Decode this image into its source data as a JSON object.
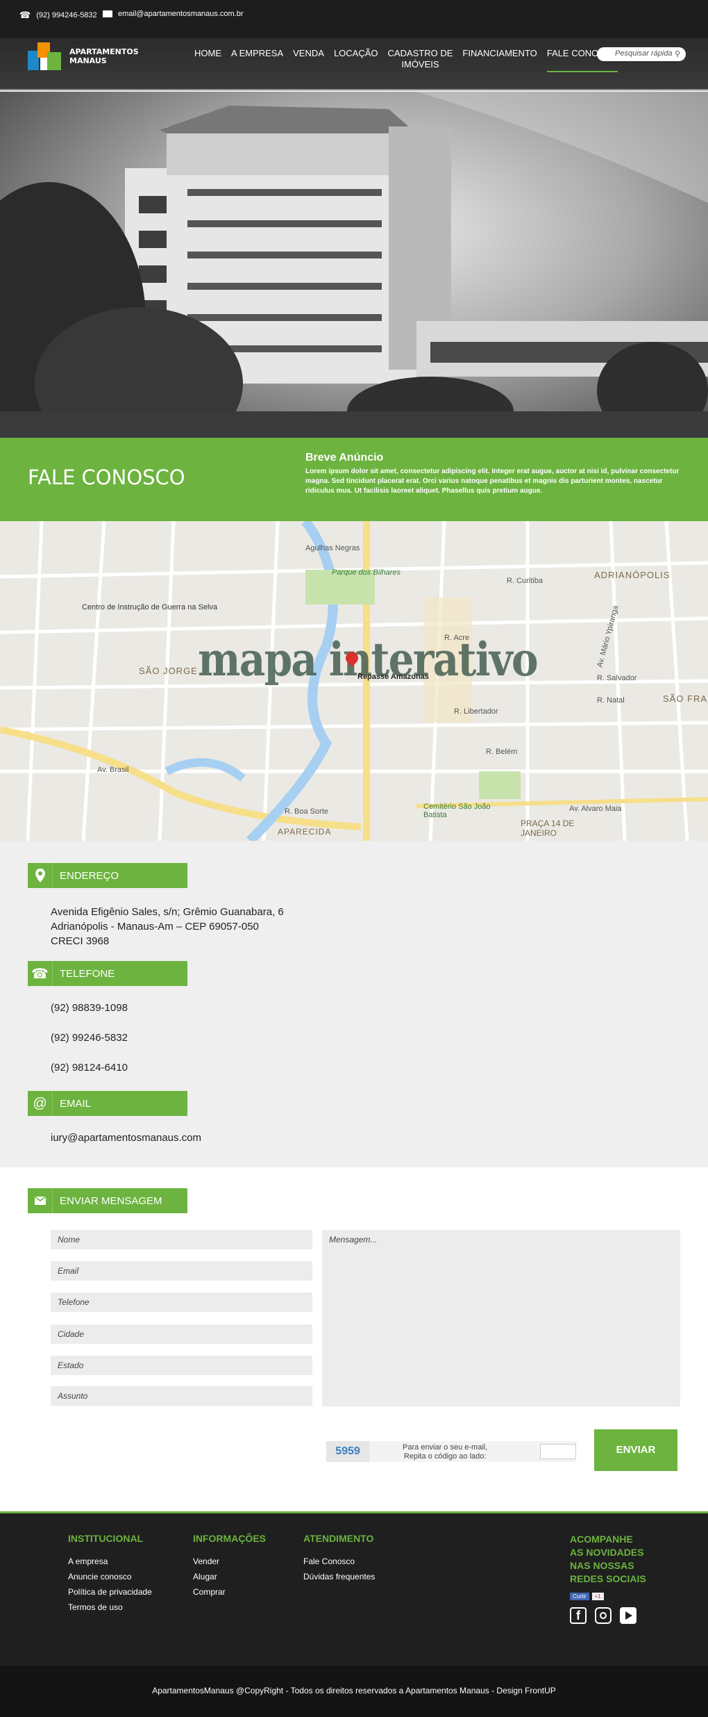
{
  "topbar": {
    "phone": "(92) 994246-5832",
    "email": "email@apartamentosmanaus.com.br"
  },
  "logo": {
    "line1": "APARTAMENTOS",
    "line2": "MANAUS"
  },
  "nav": {
    "items": [
      {
        "label": "HOME"
      },
      {
        "label": "A EMPRESA"
      },
      {
        "label": "VENDA"
      },
      {
        "label": "LOCAÇÃO"
      },
      {
        "label": "CADASTRO DE\nIMÓVEIS"
      },
      {
        "label": "FINANCIAMENTO"
      },
      {
        "label": "FALE CONOSCO",
        "active": true
      }
    ],
    "search_placeholder": "Pesquisar rápida"
  },
  "banner": {
    "title": "FALE CONOSCO",
    "subtitle": "Breve Anúncio",
    "text": "Lorem ipsum dolor sit amet, consectetur adipiscing elit. Integer erat augue, auctor at nisi id, pulvinar consectetur magna. Sed tincidunt placerat erat. Orci varius natoque penatibus et magnis dis parturient montes, nascetur ridiculus mus. Ut facilisis laoreet aliquet. Phasellus quis pretium augue."
  },
  "map": {
    "overlay": "mapa interativo",
    "marker": "Repasse Amazonas",
    "labels": [
      "Centro de Instrução de Guerra na Selva",
      "Parque dos Bilhares",
      "ADRIANÓPOLIS",
      "SÃO JORGE",
      "SÃO FRA",
      "Cemitério São João Batista",
      "PRAÇA 14 DE JANEIRO",
      "APARECIDA",
      "Av. Brasil",
      "Av. Alvaro Maia",
      "R. Salvador",
      "R. Natal",
      "R. Acre",
      "R. Belém",
      "R. Libertador",
      "R. Curitiba",
      "Av. Mário Ypiranga",
      "R. Boa Sorte",
      "Agulhas Negras"
    ]
  },
  "contact": {
    "endereco_title": "ENDEREÇO",
    "endereco_lines": [
      "Avenida Efigênio Sales, s/n; Grêmio Guanabara, 6",
      "Adrianópolis - Manaus-Am  – CEP 69057-050",
      "CRECI 3968"
    ],
    "telefone_title": "TELEFONE",
    "phones": [
      "(92) 98839-1098",
      "(92) 99246-5832",
      "(92) 98124-6410"
    ],
    "email_title": "EMAIL",
    "email": "iury@apartamentosmanaus.com"
  },
  "form": {
    "title": "ENVIAR MENSAGEM",
    "fields": [
      "Nome",
      "Email",
      "Telefone",
      "Cidade",
      "Estado",
      "Assunto"
    ],
    "message_placeholder": "Mensagem...",
    "captcha_code": "5959",
    "captcha_text1": "Para enviar o seu e-mail,",
    "captcha_text2": "Repita o código ao lado:",
    "submit": "ENVIAR"
  },
  "footer": {
    "col1": {
      "title": "INSTITUCIONAL",
      "links": [
        "A empresa",
        "Anuncie conosco",
        "Política de privacidade",
        "Termos de uso"
      ]
    },
    "col2": {
      "title": "INFORMAÇÕES",
      "links": [
        "Vender",
        "Alugar",
        "Comprar"
      ]
    },
    "col3": {
      "title": "ATENDIMENTO",
      "links": [
        "Fale Conosco",
        "Dúvidas frequentes"
      ]
    },
    "social_title": [
      "ACOMPANHE",
      "AS NOVIDADES",
      "NAS  NOSSAS",
      "REDES SOCIAIS"
    ],
    "share": "Curtir",
    "plus": "+1"
  },
  "copyright": "ApartamentosManaus @CopyRight - Todos os direitos reservados a Apartamentos Manaus - Design FrontUP",
  "colors": {
    "accent": "#6cb33f",
    "dark": "#1d1d1d"
  }
}
